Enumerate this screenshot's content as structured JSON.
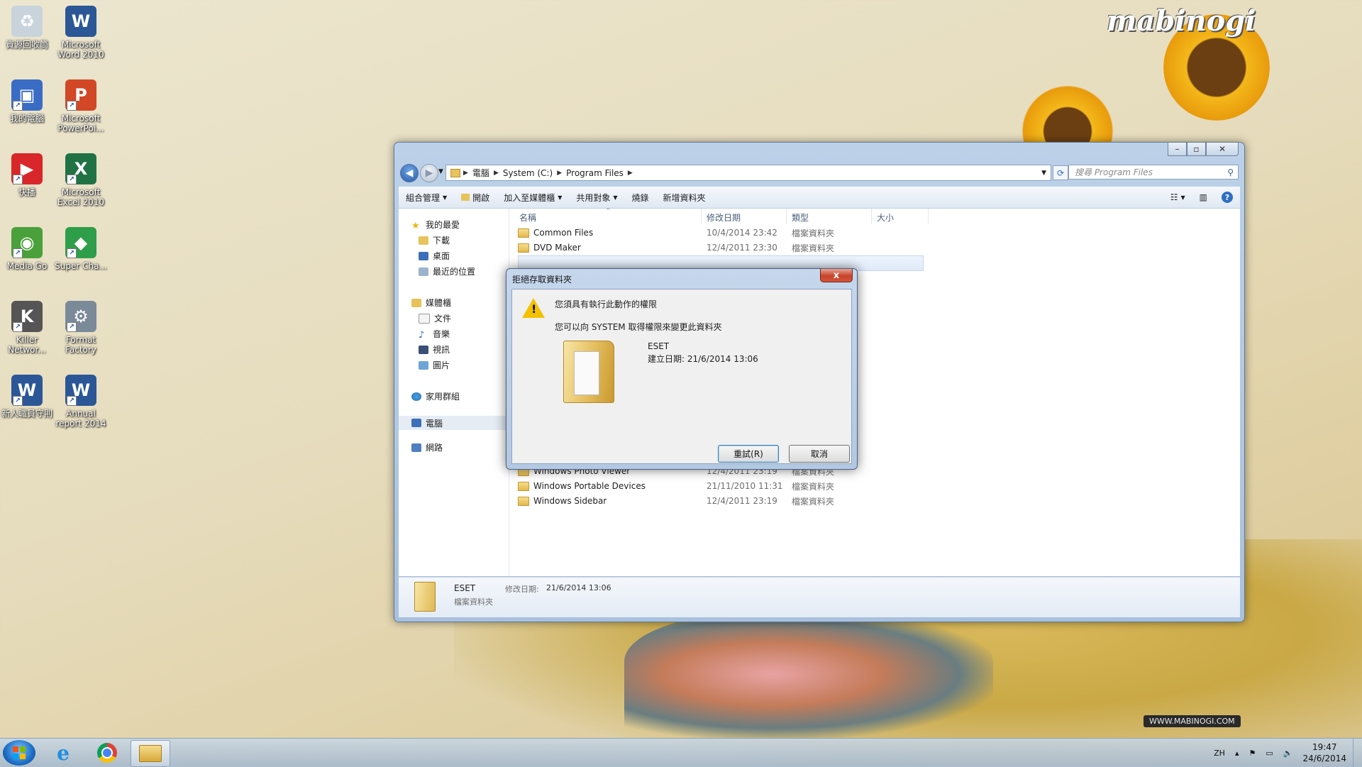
{
  "wallpaper": {
    "logo": "mabinogi",
    "url": "WWW.MABINOGI.COM"
  },
  "desktop_icons": [
    {
      "label": "資源回收筒",
      "icon": "recycle-bin-icon",
      "color": "#c9d3dc"
    },
    {
      "label": "Microsoft Word 2010",
      "icon": "word-icon",
      "color": "#2b5797"
    },
    {
      "label": "我的電腦",
      "icon": "computer-icon",
      "color": "#3a6cc6"
    },
    {
      "label": "Microsoft PowerPoi...",
      "icon": "powerpoint-icon",
      "color": "#d24726"
    },
    {
      "label": "快播",
      "icon": "qvod-icon",
      "color": "#d8262a"
    },
    {
      "label": "Microsoft Excel 2010",
      "icon": "excel-icon",
      "color": "#207245"
    },
    {
      "label": "Media Go",
      "icon": "media-go-icon",
      "color": "#4aa03a"
    },
    {
      "label": "Super Cha...",
      "icon": "super-charge-icon",
      "color": "#2f9e4a"
    },
    {
      "label": "Killer Networ...",
      "icon": "killer-network-icon",
      "color": "#555555"
    },
    {
      "label": "Format Factory",
      "icon": "format-factory-icon",
      "color": "#7b8a99"
    },
    {
      "label": "新人職員守則",
      "icon": "word-doc-icon",
      "color": "#2b5797"
    },
    {
      "label": "Annual report 2014",
      "icon": "word-doc-icon",
      "color": "#2b5797"
    }
  ],
  "explorer": {
    "breadcrumbs": [
      "電腦",
      "System (C:)",
      "Program Files"
    ],
    "search_placeholder": "搜尋 Program Files",
    "toolbar": {
      "organize": "組合管理",
      "open": "開啟",
      "include_library": "加入至媒體櫃",
      "share_with": "共用對象",
      "burn": "燒錄",
      "new_folder": "新增資料夾"
    },
    "nav": {
      "favorites": "我的最愛",
      "downloads": "下載",
      "desktop": "桌面",
      "recent": "最近的位置",
      "libraries": "媒體櫃",
      "documents": "文件",
      "music": "音樂",
      "videos": "視訊",
      "pictures": "圖片",
      "homegroup": "家用群組",
      "computer": "電腦",
      "network": "網路"
    },
    "columns": {
      "name": "名稱",
      "modified": "修改日期",
      "type": "類型",
      "size": "大小"
    },
    "files": [
      {
        "name": "Common Files",
        "date": "10/4/2014 23:42",
        "type": "檔案資料夾"
      },
      {
        "name": "DVD Maker",
        "date": "12/4/2011 23:30",
        "type": "檔案資料夾"
      },
      {
        "name": "Windows Photo Viewer",
        "date": "12/4/2011 23:19",
        "type": "檔案資料夾"
      },
      {
        "name": "Windows Portable Devices",
        "date": "21/11/2010 11:31",
        "type": "檔案資料夾"
      },
      {
        "name": "Windows Sidebar",
        "date": "12/4/2011 23:19",
        "type": "檔案資料夾"
      }
    ],
    "details": {
      "name": "ESET",
      "modified_label": "修改日期:",
      "modified": "21/6/2014 13:06",
      "type": "檔案資料夾"
    }
  },
  "dialog": {
    "title": "拒絕存取資料夾",
    "message1": "您須具有執行此動作的權限",
    "message2": "您可以向 SYSTEM 取得權限來變更此資料夾",
    "folder_name": "ESET",
    "created": "建立日期: 21/6/2014 13:06",
    "retry": "重試(R)",
    "cancel": "取消",
    "close": "x"
  },
  "taskbar": {
    "language": "ZH",
    "time": "19:47",
    "date": "24/6/2014"
  }
}
